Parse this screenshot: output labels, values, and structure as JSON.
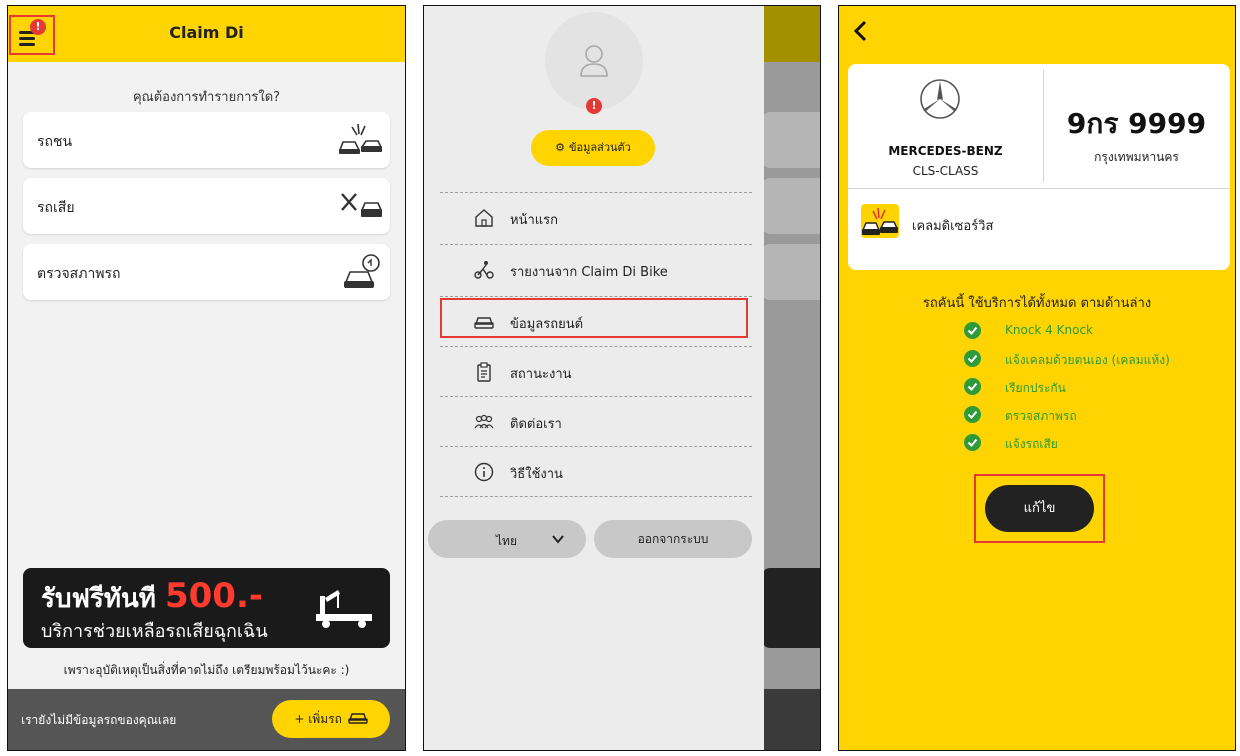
{
  "screen1": {
    "title": "Claim Di",
    "question": "คุณต้องการทำรายการใด?",
    "services": [
      {
        "label": "รถชน",
        "icon": "car-crash-icon"
      },
      {
        "label": "รถเสีย",
        "icon": "car-repair-icon"
      },
      {
        "label": "ตรวจสภาพรถ",
        "icon": "car-inspection-icon"
      }
    ],
    "promo": {
      "line1_prefix": "รับฟรีทันที",
      "amount": "500.-",
      "line2": "บริการช่วยเหลือรถเสียฉุกเฉิน"
    },
    "footnote": "เพราะอุบัติเหตุเป็นสิ่งที่คาดไม่ถึง เตรียมพร้อมไว้นะคะ :)",
    "footer": {
      "no_car_text": "เรายังไม่มีข้อมูลรถของคุณเลย",
      "add_car_label": "+ เพิ่มรถ"
    }
  },
  "screen2": {
    "profile_label": "ข้อมูลส่วนตัว",
    "menu": [
      {
        "label": "หน้าแรก",
        "icon": "home-icon"
      },
      {
        "label": "รายงานจาก Claim Di Bike",
        "icon": "bike-icon"
      },
      {
        "label": "ข้อมูลรถยนต์",
        "icon": "car-icon"
      },
      {
        "label": "สถานะงาน",
        "icon": "clipboard-icon"
      },
      {
        "label": "ติดต่อเรา",
        "icon": "people-icon"
      },
      {
        "label": "วิธีใช้งาน",
        "icon": "info-icon"
      }
    ],
    "language": "ไทย",
    "logout_label": "ออกจากระบบ"
  },
  "screen3": {
    "car": {
      "brand": "MERCEDES-BENZ",
      "model": "CLS-CLASS",
      "plate": "9กร 9999",
      "province": "กรุงเทพมหานคร"
    },
    "claim_service": "เคลมดิเซอร์วิส",
    "services_heading": "รถคันนี้ ใช้บริการได้ทั้งหมด ตามด้านล่าง",
    "services": [
      "Knock 4 Knock",
      "แจ้งเคลมด้วยตนเอง (เคลมแห้ง)",
      "เรียกประกัน",
      "ตรวจสภาพรถ",
      "แจ้งรถเสีย"
    ],
    "edit_label": "แก้ไข"
  },
  "colors": {
    "brand_yellow": "#ffd400",
    "highlight_red": "#e53935",
    "check_green": "#2d9b3a",
    "footer_gray": "#555555"
  }
}
